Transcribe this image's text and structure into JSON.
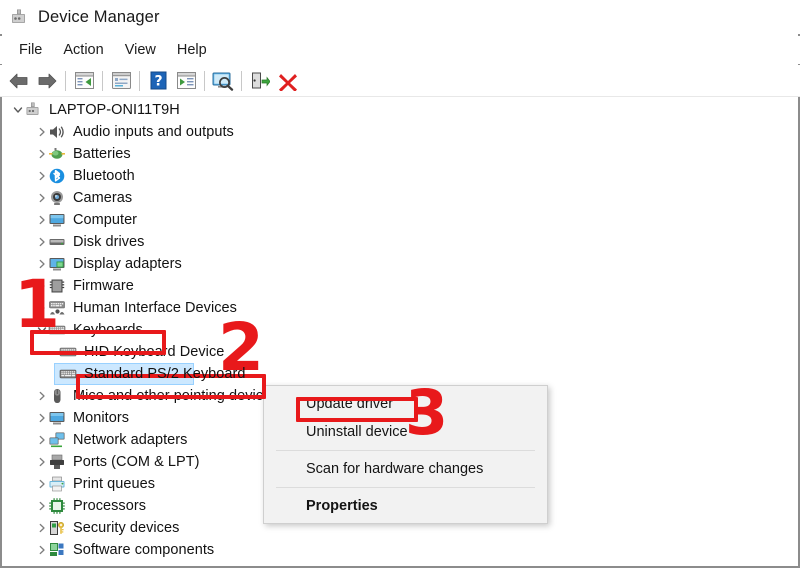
{
  "window": {
    "title": "Device Manager",
    "icon": "device-manager-icon"
  },
  "menubar": {
    "items": [
      {
        "label": "File",
        "name": "menu-file"
      },
      {
        "label": "Action",
        "name": "menu-action"
      },
      {
        "label": "View",
        "name": "menu-view"
      },
      {
        "label": "Help",
        "name": "menu-help"
      }
    ]
  },
  "toolbar": {
    "buttons": [
      {
        "name": "back-arrow-icon",
        "title": "Back"
      },
      {
        "name": "forward-arrow-icon",
        "title": "Forward"
      },
      {
        "name": "show-hide-console-tree-icon",
        "title": "Show/Hide console tree"
      },
      {
        "name": "properties-icon",
        "title": "Properties"
      },
      {
        "name": "help-icon",
        "title": "Help"
      },
      {
        "name": "update-driver-toolbar-icon",
        "title": "Update driver"
      },
      {
        "name": "scan-hardware-changes-icon",
        "title": "Scan for hardware changes"
      },
      {
        "name": "enable-device-icon",
        "title": "Enable device"
      },
      {
        "name": "uninstall-device-icon",
        "title": "Uninstall device"
      }
    ]
  },
  "tree": {
    "root": {
      "label": "LAPTOP-ONI11T9H",
      "icon": "computer-root-icon",
      "expanded": true
    },
    "items": [
      {
        "label": "Audio inputs and outputs",
        "icon": "speaker-icon",
        "depth": 1,
        "expanded": false,
        "selected": false
      },
      {
        "label": "Batteries",
        "icon": "battery-icon",
        "depth": 1,
        "expanded": false,
        "selected": false
      },
      {
        "label": "Bluetooth",
        "icon": "bluetooth-icon",
        "depth": 1,
        "expanded": false,
        "selected": false
      },
      {
        "label": "Cameras",
        "icon": "camera-icon",
        "depth": 1,
        "expanded": false,
        "selected": false
      },
      {
        "label": "Computer",
        "icon": "computer-icon",
        "depth": 1,
        "expanded": false,
        "selected": false
      },
      {
        "label": "Disk drives",
        "icon": "disk-drive-icon",
        "depth": 1,
        "expanded": false,
        "selected": false
      },
      {
        "label": "Display adapters",
        "icon": "display-adapter-icon",
        "depth": 1,
        "expanded": false,
        "selected": false
      },
      {
        "label": "Firmware",
        "icon": "firmware-icon",
        "depth": 1,
        "expanded": false,
        "selected": false
      },
      {
        "label": "Human Interface Devices",
        "icon": "hid-icon",
        "depth": 1,
        "expanded": false,
        "selected": false
      },
      {
        "label": "Keyboards",
        "icon": "keyboard-icon",
        "depth": 1,
        "expanded": true,
        "selected": false
      },
      {
        "label": "HID Keyboard Device",
        "icon": "keyboard-icon",
        "depth": 2,
        "expanded": false,
        "selected": false
      },
      {
        "label": "Standard PS/2 Keyboard",
        "icon": "keyboard-icon",
        "depth": 2,
        "expanded": false,
        "selected": true
      },
      {
        "label": "Mice and other pointing devices",
        "icon": "mouse-icon",
        "depth": 1,
        "expanded": false,
        "selected": false
      },
      {
        "label": "Monitors",
        "icon": "monitor-icon",
        "depth": 1,
        "expanded": false,
        "selected": false
      },
      {
        "label": "Network adapters",
        "icon": "network-icon",
        "depth": 1,
        "expanded": false,
        "selected": false
      },
      {
        "label": "Ports (COM & LPT)",
        "icon": "port-icon",
        "depth": 1,
        "expanded": false,
        "selected": false
      },
      {
        "label": "Print queues",
        "icon": "printer-icon",
        "depth": 1,
        "expanded": false,
        "selected": false
      },
      {
        "label": "Processors",
        "icon": "processor-icon",
        "depth": 1,
        "expanded": false,
        "selected": false
      },
      {
        "label": "Security devices",
        "icon": "security-icon",
        "depth": 1,
        "expanded": false,
        "selected": false
      },
      {
        "label": "Software components",
        "icon": "software-component-icon",
        "depth": 1,
        "expanded": false,
        "selected": false
      }
    ]
  },
  "context_menu": {
    "items": [
      {
        "label": "Update driver",
        "name": "ctx-update-driver",
        "bold": false,
        "separator_after": false
      },
      {
        "label": "Uninstall device",
        "name": "ctx-uninstall-device",
        "bold": false,
        "separator_after": true
      },
      {
        "label": "Scan for hardware changes",
        "name": "ctx-scan-hardware",
        "bold": false,
        "separator_after": true
      },
      {
        "label": "Properties",
        "name": "ctx-properties",
        "bold": true,
        "separator_after": false
      }
    ]
  },
  "annotations": {
    "color": "#e8191b",
    "steps": [
      {
        "number": "1",
        "target": "Keyboards"
      },
      {
        "number": "2",
        "target": "Standard PS/2 Keyboard"
      },
      {
        "number": "3",
        "target": "Update driver"
      }
    ]
  }
}
